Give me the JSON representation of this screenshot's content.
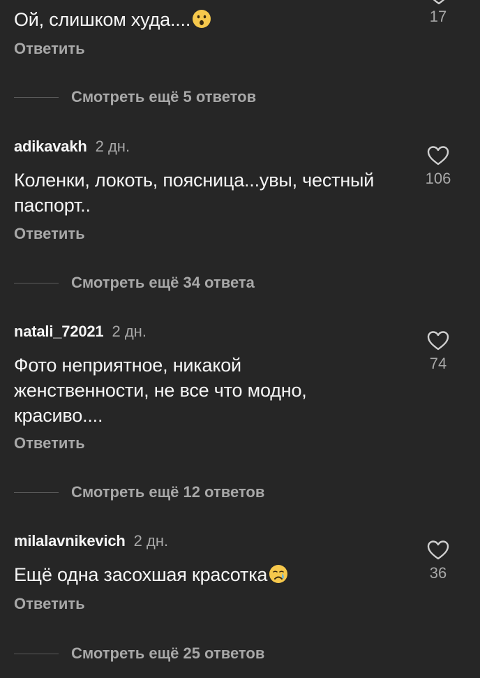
{
  "comments": [
    {
      "text": "Ой, слишком худа....",
      "emoji": "surprised-face-emoji",
      "likes": "17",
      "reply_label": "Ответить",
      "view_replies": "Смотреть ещё 5 ответов"
    },
    {
      "username": "adikavakh",
      "time": "2 дн.",
      "text": "Коленки, локоть, поясница...увы, честный паспорт..",
      "likes": "106",
      "reply_label": "Ответить",
      "view_replies": "Смотреть ещё 34 ответа"
    },
    {
      "username": "natali_72021",
      "time": "2 дн.",
      "text": "Фото неприятное, никакой женственности, не все что модно, красиво....",
      "likes": "74",
      "reply_label": "Ответить",
      "view_replies": "Смотреть ещё 12 ответов"
    },
    {
      "username": "milalavnikevich",
      "time": "2 дн.",
      "text": "Ещё одна засохшая красотка",
      "emoji": "crying-face-emoji",
      "likes": "36",
      "reply_label": "Ответить",
      "view_replies": "Смотреть ещё 25 ответов"
    }
  ],
  "colors": {
    "background": "#262626",
    "primary_text": "#f5f5f5",
    "secondary_text": "#a8a8a8",
    "emoji_yellow": "#f6c84c"
  },
  "icons": {
    "like": "heart-outline-icon"
  }
}
